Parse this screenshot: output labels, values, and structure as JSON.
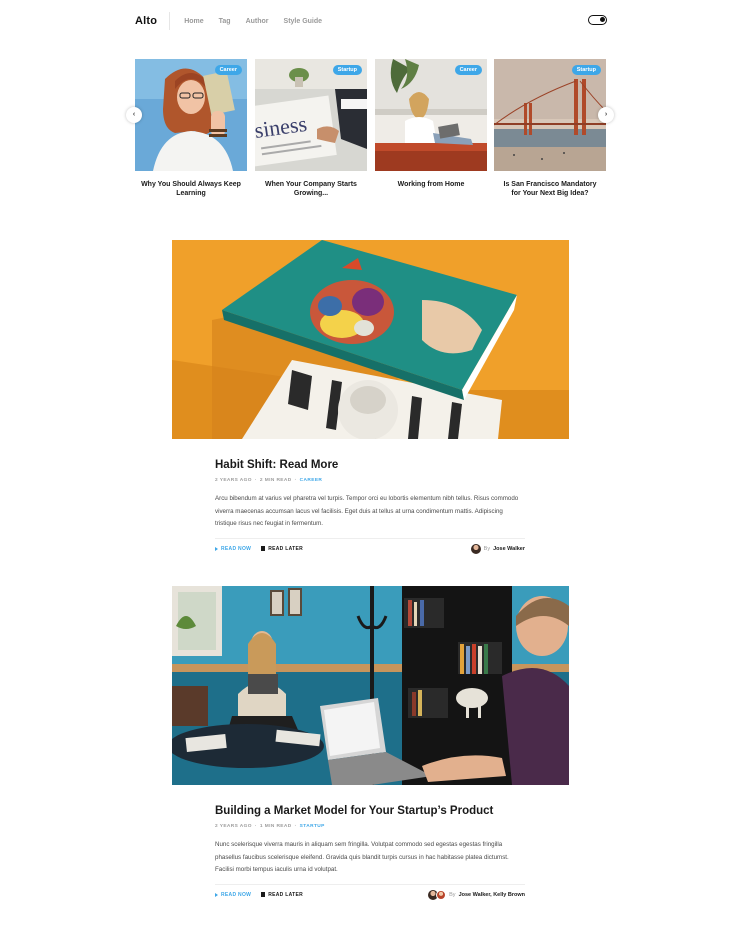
{
  "header": {
    "logo": "Alto",
    "nav": [
      "Home",
      "Tag",
      "Author",
      "Style Guide"
    ]
  },
  "carousel": {
    "items": [
      {
        "tag": "Career",
        "title": "Why You Should Always Keep Learning"
      },
      {
        "tag": "Startup",
        "title": "When Your Company Starts Growing..."
      },
      {
        "tag": "Career",
        "title": "Working from Home"
      },
      {
        "tag": "Startup",
        "title": "Is San Francisco Mandatory for Your Next Big Idea?"
      }
    ],
    "prev_glyph": "‹",
    "next_glyph": "›"
  },
  "posts": [
    {
      "title": "Habit Shift: Read More",
      "meta_time": "2 YEARS AGO",
      "meta_read": "2 MIN READ",
      "category": "CAREER",
      "excerpt": "Arcu bibendum at varius vel pharetra vel turpis. Tempor orci eu lobortis elementum nibh tellus. Risus commodo viverra maecenas accumsan lacus vel facilisis. Eget duis at tellus at urna condimentum mattis. Adipiscing tristique risus nec feugiat in fermentum.",
      "read_now": "READ NOW",
      "read_later": "READ LATER",
      "by": "By",
      "authors": "Jose Walker"
    },
    {
      "title": "Building a Market Model for Your Startup’s Product",
      "meta_time": "2 YEARS AGO",
      "meta_read": "1 MIN READ",
      "category": "STARTUP",
      "excerpt": "Nunc scelerisque viverra mauris in aliquam sem fringilla. Volutpat commodo sed egestas egestas fringilla phasellus faucibus scelerisque eleifend. Gravida quis blandit turpis cursus in hac habitasse platea dictumst. Facilisi morbi tempus iaculis urna id volutpat.",
      "read_now": "READ NOW",
      "read_later": "READ LATER",
      "by": "By",
      "authors": "Jose Walker, Kelly Brown"
    }
  ],
  "colors": {
    "accent": "#3ea7e8",
    "hero1_bg": "#f0a02a",
    "book_teal": "#1f8f85"
  }
}
